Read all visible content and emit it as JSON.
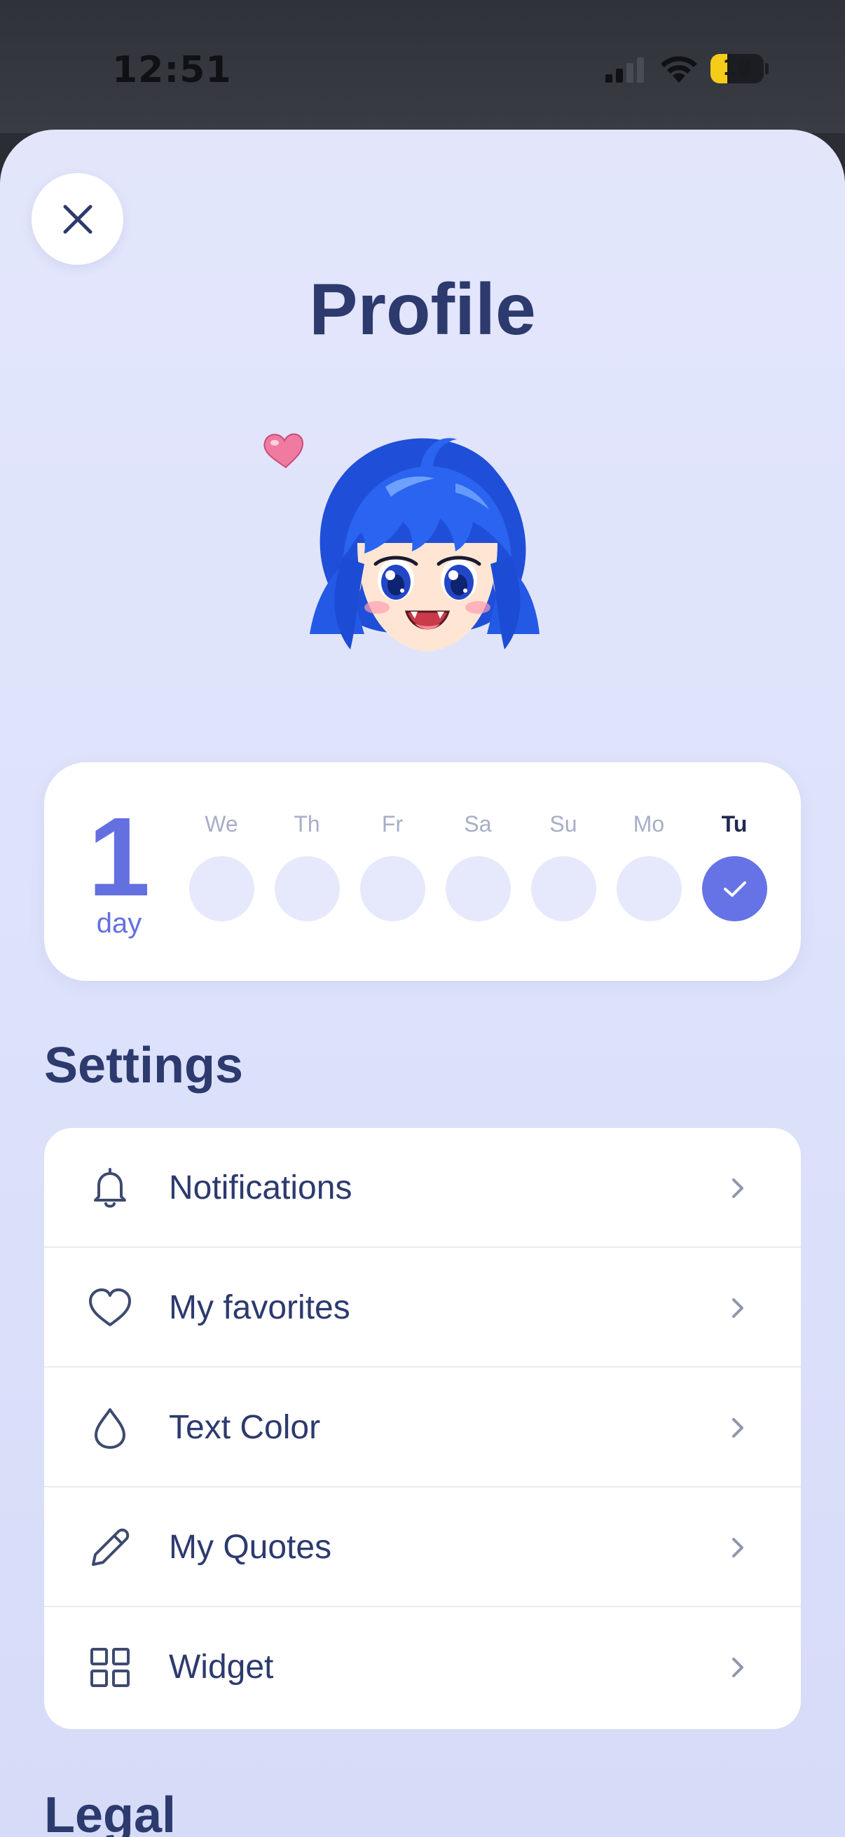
{
  "status_bar": {
    "time": "12:51",
    "battery_level": "18",
    "battery_fraction": 0.18,
    "battery_color": "#f5cc1a",
    "signal_strength_bars": 2
  },
  "header": {
    "close_icon": "close-icon",
    "title": "Profile"
  },
  "avatar": {
    "icon": "anime-girl-avatar-with-heart"
  },
  "streak": {
    "count": "1",
    "unit": "day",
    "days": [
      {
        "label": "We",
        "completed": false
      },
      {
        "label": "Th",
        "completed": false
      },
      {
        "label": "Fr",
        "completed": false
      },
      {
        "label": "Sa",
        "completed": false
      },
      {
        "label": "Su",
        "completed": false
      },
      {
        "label": "Mo",
        "completed": false
      },
      {
        "label": "Tu",
        "completed": true
      }
    ],
    "accent_color": "#6470e0"
  },
  "settings": {
    "title": "Settings",
    "items": [
      {
        "label": "Notifications",
        "icon": "bell-icon"
      },
      {
        "label": "My favorites",
        "icon": "heart-icon"
      },
      {
        "label": "Text Color",
        "icon": "droplet-icon"
      },
      {
        "label": "My Quotes",
        "icon": "pencil-icon"
      },
      {
        "label": "Widget",
        "icon": "grid-icon"
      }
    ]
  },
  "legal": {
    "title": "Legal"
  },
  "colors": {
    "primary_text": "#2c3a6e",
    "background": "#e0e4fb",
    "card": "#ffffff"
  }
}
